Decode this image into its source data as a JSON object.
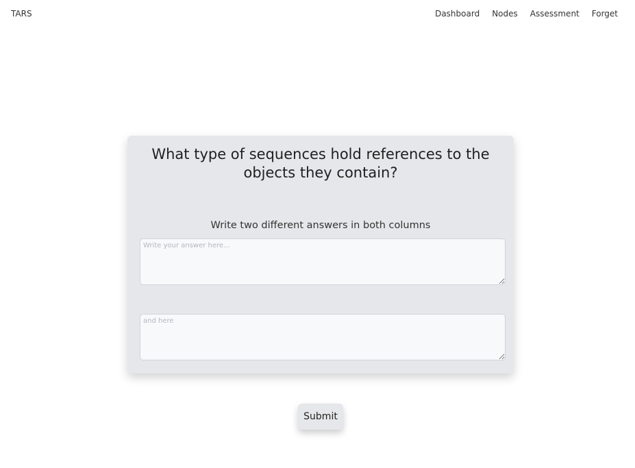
{
  "nav": {
    "brand": "TARS",
    "links": [
      "Dashboard",
      "Nodes",
      "Assessment",
      "Forget"
    ]
  },
  "card": {
    "question": "What type of sequences hold references to the objects they contain?",
    "instruction": "Write two different answers in both columns",
    "answer1": {
      "value": "",
      "placeholder": "Write your answer here..."
    },
    "answer2": {
      "value": "",
      "placeholder": "and here"
    }
  },
  "submit_label": "Submit"
}
